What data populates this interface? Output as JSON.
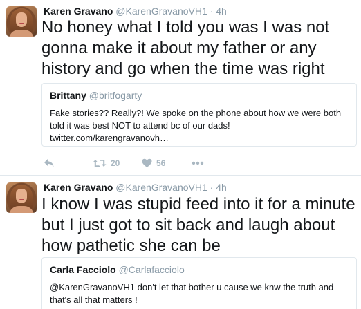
{
  "tweets": [
    {
      "name": "Karen Gravano",
      "handle": "@KarenGravanoVH1",
      "separator": "·",
      "time": "4h",
      "text": "No honey what I told you was I was not gonna make it about my father or any history and go when the time was right",
      "quote": {
        "name": "Brittany",
        "handle": "@britfogarty",
        "text": "Fake stories?? Really?! We spoke on the phone about how we were both told it was best NOT to attend bc of our dads!",
        "link": "twitter.com/karengravanovh…"
      },
      "actions": {
        "reply_icon": "reply-icon",
        "retweet_icon": "retweet-icon",
        "retweets": "20",
        "like_icon": "heart-icon",
        "likes": "56",
        "more_icon": "more-icon"
      }
    },
    {
      "name": "Karen Gravano",
      "handle": "@KarenGravanoVH1",
      "separator": "·",
      "time": "4h",
      "text": "I know I was stupid feed into it  for a minute but I just got to sit back and laugh about how pathetic she can be",
      "quote": {
        "name": "Carla Facciolo",
        "handle": "@Carlafacciolo",
        "text": "@KarenGravanoVH1 don't let that bother u cause we knw the truth and that's all that matters !"
      }
    }
  ],
  "colors": {
    "text": "#14171a",
    "muted": "#8899a6",
    "action": "#aab8c2",
    "border": "#e1e8ed"
  }
}
